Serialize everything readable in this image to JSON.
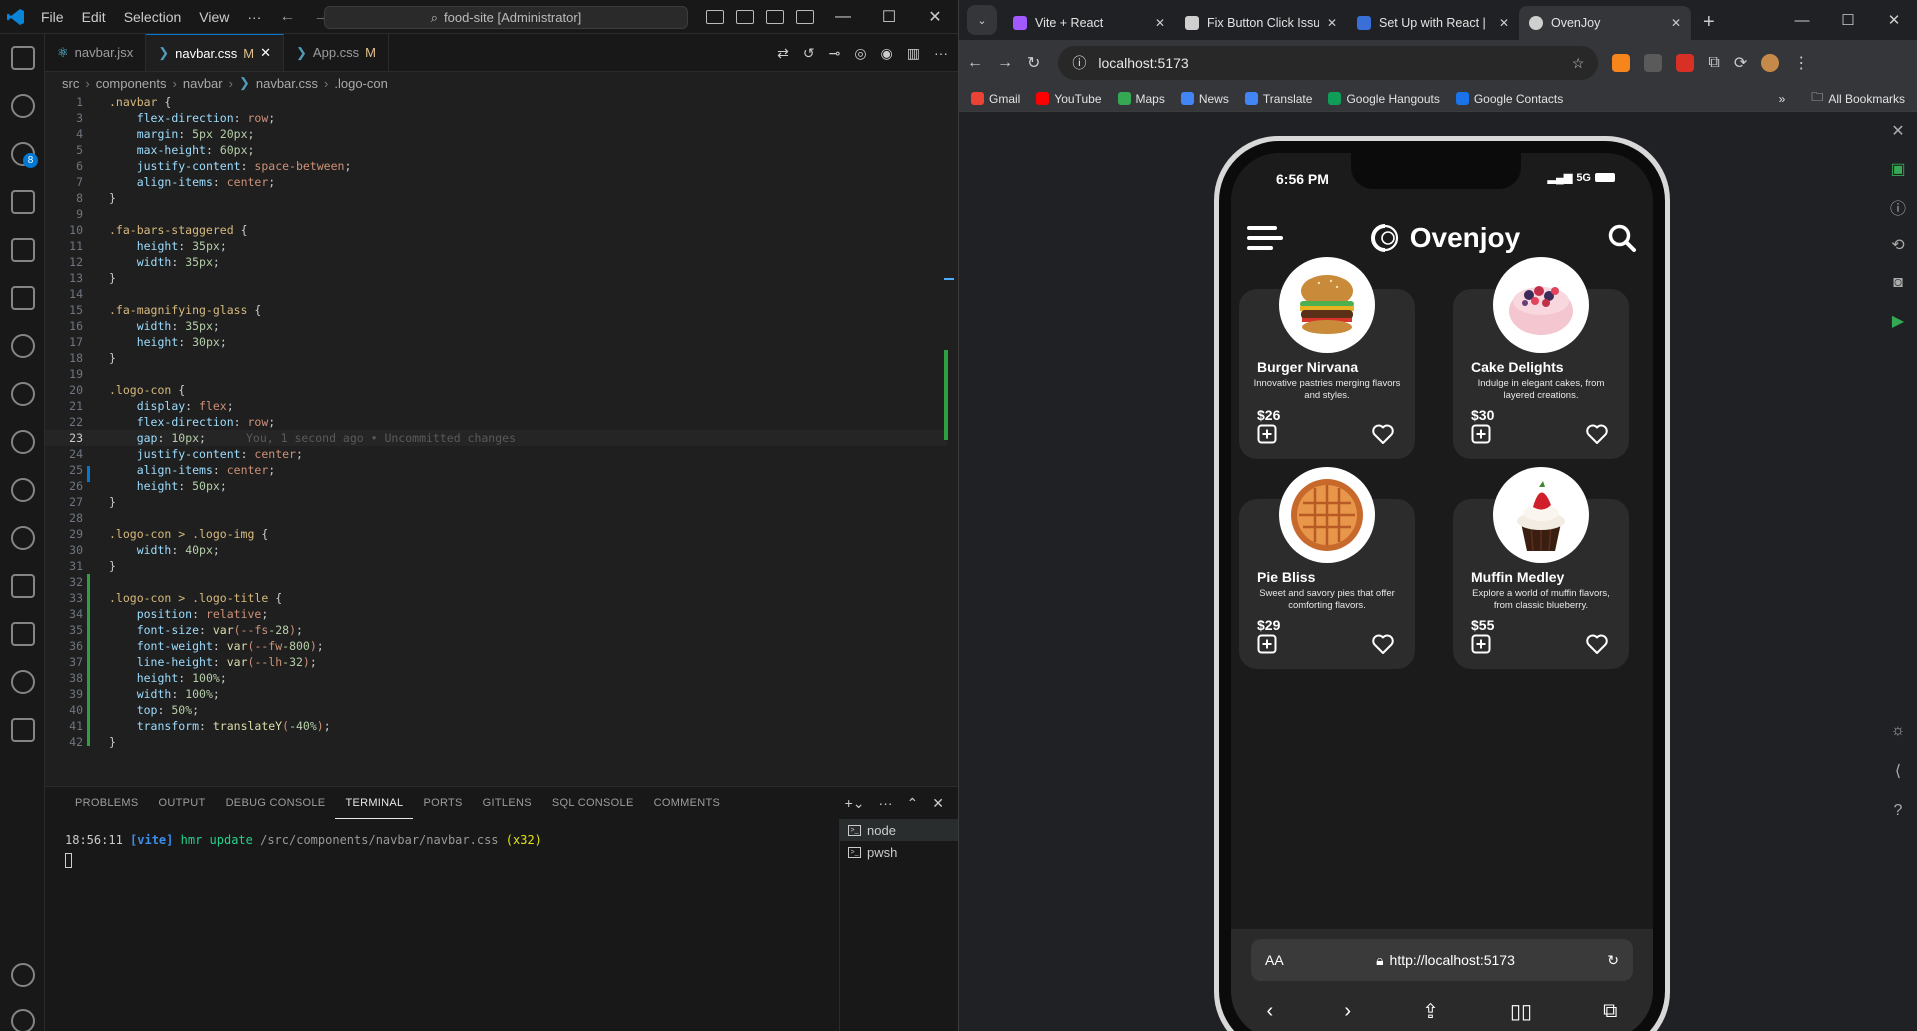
{
  "vscode": {
    "menu": [
      "File",
      "Edit",
      "Selection",
      "View",
      "···"
    ],
    "command_center": "food-site [Administrator]",
    "tabs": [
      {
        "label": "navbar.jsx",
        "modified": ""
      },
      {
        "label": "navbar.css",
        "modified": "M"
      },
      {
        "label": "App.css",
        "modified": "M"
      }
    ],
    "breadcrumb": [
      "src",
      "components",
      "navbar",
      "navbar.css",
      ".logo-con"
    ],
    "scm_badge": "8",
    "code_lines": [
      {
        "n": "1",
        "t": ".navbar {"
      },
      {
        "n": "3",
        "t": "    flex-direction: row;"
      },
      {
        "n": "4",
        "t": "    margin: 5px 20px;"
      },
      {
        "n": "5",
        "t": "    max-height: 60px;"
      },
      {
        "n": "6",
        "t": "    justify-content: space-between;"
      },
      {
        "n": "7",
        "t": "    align-items: center;"
      },
      {
        "n": "8",
        "t": "}"
      },
      {
        "n": "9",
        "t": ""
      },
      {
        "n": "10",
        "t": ".fa-bars-staggered {"
      },
      {
        "n": "11",
        "t": "    height: 35px;"
      },
      {
        "n": "12",
        "t": "    width: 35px;"
      },
      {
        "n": "13",
        "t": "}"
      },
      {
        "n": "14",
        "t": ""
      },
      {
        "n": "15",
        "t": ".fa-magnifying-glass {"
      },
      {
        "n": "16",
        "t": "    width: 35px;"
      },
      {
        "n": "17",
        "t": "    height: 30px;"
      },
      {
        "n": "18",
        "t": "}"
      },
      {
        "n": "19",
        "t": ""
      },
      {
        "n": "20",
        "t": ".logo-con {"
      },
      {
        "n": "21",
        "t": "    display: flex;"
      },
      {
        "n": "22",
        "t": "    flex-direction: row;"
      },
      {
        "n": "23",
        "t": "    gap: 10px;"
      },
      {
        "n": "24",
        "t": "    justify-content: center;"
      },
      {
        "n": "25",
        "t": "    align-items: center;"
      },
      {
        "n": "26",
        "t": "    height: 50px;"
      },
      {
        "n": "27",
        "t": "}"
      },
      {
        "n": "28",
        "t": ""
      },
      {
        "n": "29",
        "t": ".logo-con > .logo-img {"
      },
      {
        "n": "30",
        "t": "    width: 40px;"
      },
      {
        "n": "31",
        "t": "}"
      },
      {
        "n": "32",
        "t": ""
      },
      {
        "n": "33",
        "t": ".logo-con > .logo-title {"
      },
      {
        "n": "34",
        "t": "    position: relative;"
      },
      {
        "n": "35",
        "t": "    font-size: var(--fs-28);"
      },
      {
        "n": "36",
        "t": "    font-weight: var(--fw-800);"
      },
      {
        "n": "37",
        "t": "    line-height: var(--lh-32);"
      },
      {
        "n": "38",
        "t": "    height: 100%;"
      },
      {
        "n": "39",
        "t": "    width: 100%;"
      },
      {
        "n": "40",
        "t": "    top: 50%;"
      },
      {
        "n": "41",
        "t": "    transform: translateY(-40%);"
      },
      {
        "n": "42",
        "t": "}"
      }
    ],
    "cursor_line": "23",
    "blame": "You, 1 second ago • Uncommitted changes",
    "panel_tabs": [
      "PROBLEMS",
      "OUTPUT",
      "DEBUG CONSOLE",
      "TERMINAL",
      "PORTS",
      "GITLENS",
      "SQL CONSOLE",
      "COMMENTS"
    ],
    "active_panel_tab": "TERMINAL",
    "terminal": {
      "time": "18:56:11",
      "tag": "[vite]",
      "event": "hmr update",
      "path": "/src/components/navbar/navbar.css",
      "count": "(x32)"
    },
    "terminal_instances": [
      "node",
      "pwsh"
    ]
  },
  "chrome": {
    "tabs": [
      {
        "label": "Vite + React",
        "color": "#a259ff"
      },
      {
        "label": "Fix Button Click Issu",
        "color": "#cfcfcf"
      },
      {
        "label": "Set Up with React |",
        "color": "#3b6fd8"
      },
      {
        "label": "OvenJoy",
        "color": "#cfcfcf"
      }
    ],
    "active_tab": 3,
    "url": "localhost:5173",
    "bookmarks": [
      {
        "label": "Gmail",
        "color": "#ea4335"
      },
      {
        "label": "YouTube",
        "color": "#ff0000"
      },
      {
        "label": "Maps",
        "color": "#34a853"
      },
      {
        "label": "News",
        "color": "#4285f4"
      },
      {
        "label": "Translate",
        "color": "#4285f4"
      },
      {
        "label": "Google Hangouts",
        "color": "#0f9d58"
      },
      {
        "label": "Google Contacts",
        "color": "#1a73e8"
      }
    ],
    "all_bookmarks": "All Bookmarks"
  },
  "phone": {
    "time": "6:56 PM",
    "signal": "5G",
    "app_title": "Ovenjoy",
    "products": [
      {
        "name": "Burger Nirvana",
        "desc": "Innovative pastries merging flavors and styles.",
        "price": "$26",
        "image": "burger"
      },
      {
        "name": "Cake Delights",
        "desc": "Indulge in elegant cakes, from layered creations.",
        "price": "$30",
        "image": "cake"
      },
      {
        "name": "Pie Bliss",
        "desc": "Sweet and savory pies that offer comforting flavors.",
        "price": "$29",
        "image": "pie"
      },
      {
        "name": "Muffin Medley",
        "desc": "Explore a world of muffin flavors, from classic blueberry.",
        "price": "$55",
        "image": "muffin"
      }
    ],
    "safari": {
      "aa": "AA",
      "url": "http://localhost:5173"
    }
  },
  "colors": {
    "vscode_bg": "#1f1f1f",
    "accent_blue": "#0078d4",
    "added_green": "#2ea043",
    "card_bg": "#2c2c2c"
  }
}
